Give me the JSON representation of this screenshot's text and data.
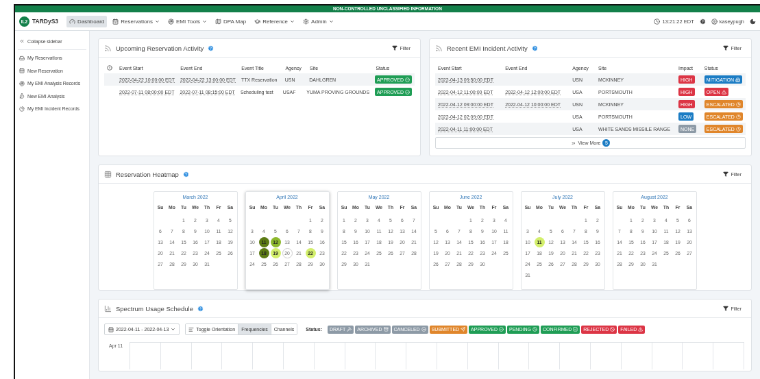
{
  "banner": "NON-CONTROLLED UNCLASSIFIED INFORMATION",
  "brand": {
    "badge": "IL2",
    "name": "TARDyS3"
  },
  "nav": [
    {
      "label": "Dashboard",
      "dropdown": false,
      "selected": true
    },
    {
      "label": "Reservations",
      "dropdown": true,
      "selected": false
    },
    {
      "label": "EMI Tools",
      "dropdown": true,
      "selected": false
    },
    {
      "label": "DPA Map",
      "dropdown": false,
      "selected": false
    },
    {
      "label": "Reference",
      "dropdown": true,
      "selected": false
    },
    {
      "label": "Admin",
      "dropdown": true,
      "selected": false
    }
  ],
  "clock": "13:21:22 EDT",
  "user": "kaseypugh",
  "sidebar": {
    "collapse": "Collapse sidebar",
    "items": [
      "My Reservations",
      "New Reservation",
      "My EMI Analysis Records",
      "New EMI Analysis",
      "My EMI Incident Records"
    ]
  },
  "upcoming": {
    "title": "Upcoming Reservation Activity",
    "filter": "Filter",
    "columns": [
      "Event Start",
      "Event End",
      "Event Title",
      "Agency",
      "Site",
      "Status"
    ],
    "rows": [
      {
        "cells": [
          "2022-04-22 10:00:00 EDT",
          "2022-04-22 13:00:00 EDT",
          "TTX Reservation",
          "USN",
          "DAHLGREN"
        ],
        "status": {
          "label": "APPROVED",
          "color": "#1f9d55",
          "kind": "approved"
        }
      },
      {
        "cells": [
          "2022-07-11 08:00:00 EDT",
          "2022-07-11 08:15:00 EDT",
          "Scheduling test",
          "USAF",
          "YUMA PROVING GROUNDS"
        ],
        "status": {
          "label": "APPROVED",
          "color": "#1f9d55",
          "kind": "approved"
        }
      }
    ]
  },
  "incidents": {
    "title": "Recent EMI Incident Activity",
    "filter": "Filter",
    "columns": [
      "Event Start",
      "Event End",
      "Agency",
      "Site",
      "Impact",
      "Status"
    ],
    "rows": [
      {
        "start": "2022-04-13 09:50:00 EDT",
        "agency": "USN",
        "site": "MCKINNEY",
        "impact": {
          "label": "HIGH",
          "color": "#dc3545"
        },
        "status": {
          "label": "MITIGATION",
          "color": "#1b7cc4",
          "kind": "mitigation"
        }
      },
      {
        "start": "2022-04-12 11:00:00 EDT",
        "end": "2022-04-12 12:00:00 EDT",
        "agency": "USA",
        "site": "PORTSMOUTH",
        "impact": {
          "label": "HIGH",
          "color": "#dc3545"
        },
        "status": {
          "label": "OPEN",
          "color": "#dc3545",
          "kind": "open"
        }
      },
      {
        "start": "2022-04-12 09:00:00 EDT",
        "end": "2022-04-12 10:00:00 EDT",
        "agency": "USN",
        "site": "MCKINNEY",
        "impact": {
          "label": "HIGH",
          "color": "#dc3545"
        },
        "status": {
          "label": "ESCALATED",
          "color": "#e0862b",
          "kind": "escalated"
        }
      },
      {
        "start": "2022-04-12 02:09:00 EDT",
        "agency": "USA",
        "site": "PORTSMOUTH",
        "impact": {
          "label": "LOW",
          "color": "#1b7cc4"
        },
        "status": {
          "label": "ESCALATED",
          "color": "#e0862b",
          "kind": "escalated"
        }
      },
      {
        "start": "2022-04-11 11:00:00 EDT",
        "agency": "USA",
        "site": "WHITE SANDS MISSILE RANGE",
        "impact": {
          "label": "NONE",
          "color": "#8d9aa6"
        },
        "status": {
          "label": "ESCALATED",
          "color": "#e0862b",
          "kind": "escalated"
        }
      }
    ],
    "view_more": "View More",
    "view_more_count": "5"
  },
  "heatmap": {
    "title": "Reservation Heatmap",
    "filter": "Filter",
    "months": [
      {
        "name": "March 2022",
        "selected": false,
        "weekdays": [
          "Su",
          "Mo",
          "Tu",
          "We",
          "Th",
          "Fr",
          "Sa"
        ],
        "weeks": [
          [
            "1",
            "2",
            "3",
            "4",
            "5"
          ],
          [
            "6",
            "7",
            "8",
            "9",
            "10",
            "11",
            "12"
          ],
          [
            "13",
            "14",
            "15",
            "16",
            "17",
            "18",
            "19"
          ],
          [
            "20",
            "21",
            "22",
            "23",
            "24",
            "25",
            "26"
          ],
          [
            "27",
            "28",
            "29",
            "30",
            "31"
          ]
        ]
      },
      {
        "name": "April 2022",
        "selected": true,
        "weekdays": [
          "Su",
          "Mo",
          "Tu",
          "We",
          "Th",
          "Fr",
          "Sa"
        ],
        "weeks": [
          [
            "1",
            "2"
          ],
          [
            "3",
            "4",
            "5",
            "6",
            "7",
            "8",
            "9"
          ],
          [
            "10",
            {
              "d": "11",
              "color": "#5b7a14"
            },
            {
              "d": "12",
              "color": "#8db82c"
            },
            "13",
            "14",
            "15",
            "16"
          ],
          [
            "17",
            {
              "d": "18",
              "color": "#5b7a14"
            },
            {
              "d": "19",
              "color": "#d3ef6c"
            },
            {
              "d": "20",
              "today": true
            },
            "21",
            {
              "d": "22",
              "color": "#d3ef6c"
            },
            "23"
          ],
          [
            "24",
            "25",
            "26",
            "27",
            "28",
            "29",
            "30"
          ]
        ]
      },
      {
        "name": "May 2022",
        "selected": false,
        "weekdays": [
          "Su",
          "Mo",
          "Tu",
          "We",
          "Th",
          "Fr",
          "Sa"
        ],
        "weeks": [
          [
            "1",
            "2",
            "3",
            "4",
            "5",
            "6",
            "7"
          ],
          [
            "8",
            "9",
            "10",
            "11",
            "12",
            "13",
            "14"
          ],
          [
            "15",
            "16",
            "17",
            "18",
            "19",
            "20",
            "21"
          ],
          [
            "22",
            "23",
            "24",
            "25",
            "26",
            "27",
            "28"
          ],
          [
            "29",
            "30",
            "31"
          ]
        ]
      },
      {
        "name": "June 2022",
        "selected": false,
        "weekdays": [
          "Su",
          "Mo",
          "Tu",
          "We",
          "Th",
          "Fr",
          "Sa"
        ],
        "weeks": [
          [
            "1",
            "2",
            "3",
            "4"
          ],
          [
            "5",
            "6",
            "7",
            "8",
            "9",
            "10",
            "11"
          ],
          [
            "12",
            "13",
            "14",
            "15",
            "16",
            "17",
            "18"
          ],
          [
            "19",
            "20",
            "21",
            "22",
            "23",
            "24",
            "25"
          ],
          [
            "26",
            "27",
            "28",
            "29",
            "30"
          ]
        ]
      },
      {
        "name": "July 2022",
        "selected": false,
        "weekdays": [
          "Su",
          "Mo",
          "Tu",
          "We",
          "Th",
          "Fr",
          "Sa"
        ],
        "weeks": [
          [
            "1",
            "2"
          ],
          [
            "3",
            "4",
            "5",
            "6",
            "7",
            "8",
            "9"
          ],
          [
            "10",
            {
              "d": "11",
              "color": "#d3ef6c"
            },
            "12",
            "13",
            "14",
            "15",
            "16"
          ],
          [
            "17",
            "18",
            "19",
            "20",
            "21",
            "22",
            "23"
          ],
          [
            "24",
            "25",
            "26",
            "27",
            "28",
            "29",
            "30"
          ],
          [
            "31"
          ]
        ]
      },
      {
        "name": "August 2022",
        "selected": false,
        "weekdays": [
          "Su",
          "Mo",
          "Tu",
          "We",
          "Th",
          "Fr",
          "Sa"
        ],
        "weeks": [
          [
            "1",
            "2",
            "3",
            "4",
            "5",
            "6"
          ],
          [
            "7",
            "8",
            "9",
            "10",
            "11",
            "12",
            "13"
          ],
          [
            "14",
            "15",
            "16",
            "17",
            "18",
            "19",
            "20"
          ],
          [
            "21",
            "22",
            "23",
            "24",
            "25",
            "26",
            "27"
          ],
          [
            "28",
            "29",
            "30",
            "31"
          ]
        ]
      }
    ]
  },
  "schedule": {
    "title": "Spectrum Usage Schedule",
    "filter": "Filter",
    "date_range": "2022-04-11 - 2022-04-13",
    "toggle": "Toggle Orientation",
    "views": [
      {
        "label": "Frequencies",
        "selected": true
      },
      {
        "label": "Channels",
        "selected": false
      }
    ],
    "status_label": "Status:",
    "legend": [
      {
        "label": "DRAFT",
        "color": "#8d9aa6",
        "kind": "draft"
      },
      {
        "label": "ARCHIVED",
        "color": "#8d9aa6",
        "kind": "archived"
      },
      {
        "label": "CANCELED",
        "color": "#8d9aa6",
        "kind": "canceled"
      },
      {
        "label": "SUBMITTED",
        "color": "#e0862b",
        "kind": "submitted"
      },
      {
        "label": "APPROVED",
        "color": "#1f9d55",
        "kind": "approved"
      },
      {
        "label": "PENDING",
        "color": "#1f9d55",
        "kind": "pending"
      },
      {
        "label": "CONFIRMED",
        "color": "#1f9d55",
        "kind": "confirmed"
      },
      {
        "label": "REJECTED",
        "color": "#dc3545",
        "kind": "rejected"
      },
      {
        "label": "FAILED",
        "color": "#dc3545",
        "kind": "failed"
      }
    ],
    "row_label": "Apr 11"
  }
}
